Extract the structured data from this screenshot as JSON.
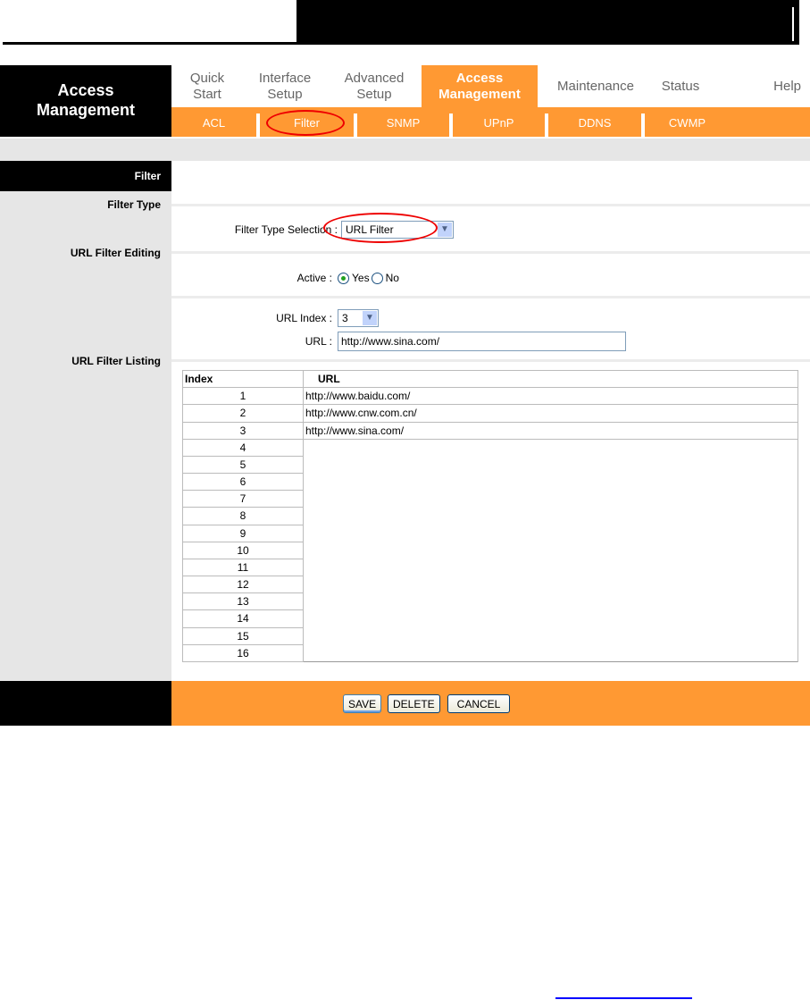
{
  "brand": {
    "line1": "Access",
    "line2": "Management"
  },
  "tabs": [
    {
      "l1": "Quick",
      "l2": "Start"
    },
    {
      "l1": "Interface",
      "l2": "Setup"
    },
    {
      "l1": "Advanced",
      "l2": "Setup"
    },
    {
      "l1": "Access",
      "l2": "Management"
    },
    {
      "l1": "Maintenance",
      "l2": ""
    },
    {
      "l1": "Status",
      "l2": ""
    },
    {
      "l1": "Help",
      "l2": ""
    }
  ],
  "subtabs": [
    "ACL",
    "Filter",
    "SNMP",
    "UPnP",
    "DDNS",
    "CWMP"
  ],
  "section": {
    "title": "Filter",
    "filter_type": "Filter Type",
    "editing": "URL Filter Editing",
    "listing": "URL Filter Listing"
  },
  "form": {
    "filter_type_label": "Filter Type Selection :",
    "filter_type_value": "URL Filter",
    "active_label": "Active :",
    "yes": "Yes",
    "no": "No",
    "url_index_label": "URL Index :",
    "url_index_value": "3",
    "url_label": "URL :",
    "url_value": "http://www.sina.com/"
  },
  "table": {
    "headers": [
      "Index",
      "URL"
    ],
    "rows": [
      [
        "1",
        "http://www.baidu.com/"
      ],
      [
        "2",
        "http://www.cnw.com.cn/"
      ],
      [
        "3",
        "http://www.sina.com/"
      ],
      [
        "4",
        ""
      ],
      [
        "5",
        ""
      ],
      [
        "6",
        ""
      ],
      [
        "7",
        ""
      ],
      [
        "8",
        ""
      ],
      [
        "9",
        ""
      ],
      [
        "10",
        ""
      ],
      [
        "11",
        ""
      ],
      [
        "12",
        ""
      ],
      [
        "13",
        ""
      ],
      [
        "14",
        ""
      ],
      [
        "15",
        ""
      ],
      [
        "16",
        ""
      ]
    ]
  },
  "buttons": {
    "save": "SAVE",
    "delete": "DELETE",
    "cancel": "CANCEL"
  },
  "colors": {
    "accent": "#ff9933",
    "highlight": "#ee0000"
  }
}
